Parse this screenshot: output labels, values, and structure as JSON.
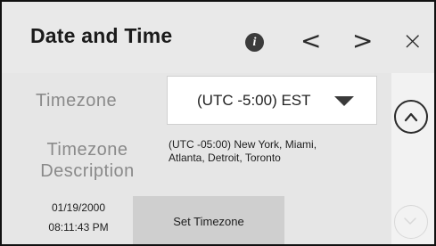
{
  "header": {
    "title": "Date and Time",
    "info_icon": "info-icon",
    "prev_icon": "chevron-left-icon",
    "next_icon": "chevron-right-icon",
    "close_icon": "close-icon",
    "prev_glyph": "<",
    "next_glyph": ">",
    "close_glyph": "×"
  },
  "timezone": {
    "label": "Timezone",
    "selected_value": "(UTC -5:00) EST",
    "dropdown_icon": "caret-down-icon"
  },
  "description": {
    "label_line1": "Timezone",
    "label_line2": "Description",
    "value_line1": "(UTC -05:00) New York, Miami,",
    "value_line2": "Atlanta, Detroit, Toronto"
  },
  "clock": {
    "date": "01/19/2000",
    "time": "08:11:43 PM"
  },
  "actions": {
    "set_timezone_label": "Set Timezone"
  },
  "scroll": {
    "up_icon": "chevron-up-icon",
    "down_icon": "chevron-down-icon",
    "up_enabled": true,
    "down_enabled": false
  },
  "colors": {
    "header_bg": "#e9e9e9",
    "content_bg": "#e6e6e6",
    "label_gray": "#8a8a8a",
    "button_bg": "#cfcfcf"
  }
}
